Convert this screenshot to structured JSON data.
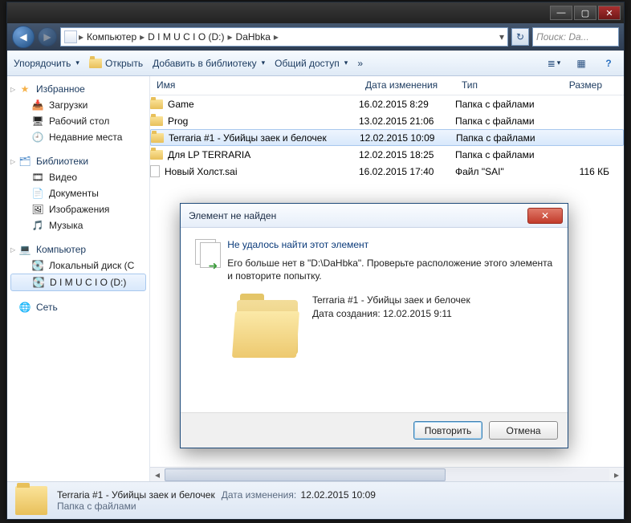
{
  "titlebar": {
    "min": "—",
    "max": "▢",
    "close": "✕"
  },
  "breadcrumbs": [
    "Компьютер",
    "D I M U C I O (D:)",
    "DaHbka"
  ],
  "search_placeholder": "Поиск: Da...",
  "toolbar": {
    "organize": "Упорядочить",
    "open": "Открыть",
    "add_lib": "Добавить в библиотеку",
    "share": "Общий доступ",
    "view": "≣",
    "preview": "▦",
    "help": "?"
  },
  "sidebar": {
    "favorites": {
      "label": "Избранное",
      "items": [
        "Загрузки",
        "Рабочий стол",
        "Недавние места"
      ]
    },
    "libraries": {
      "label": "Библиотеки",
      "items": [
        "Видео",
        "Документы",
        "Изображения",
        "Музыка"
      ]
    },
    "computer": {
      "label": "Компьютер",
      "items": [
        "Локальный диск (C",
        "D I M U C I O (D:)"
      ]
    },
    "network": {
      "label": "Сеть"
    }
  },
  "columns": {
    "name": "Имя",
    "date": "Дата изменения",
    "type": "Тип",
    "size": "Размер"
  },
  "files": [
    {
      "name": "Game",
      "date": "16.02.2015 8:29",
      "type": "Папка с файлами",
      "size": "",
      "kind": "folder"
    },
    {
      "name": "Prog",
      "date": "13.02.2015 21:06",
      "type": "Папка с файлами",
      "size": "",
      "kind": "folder"
    },
    {
      "name": "Terraria #1 - Убийцы заек и белочек",
      "date": "12.02.2015 10:09",
      "type": "Папка с файлами",
      "size": "",
      "kind": "folder",
      "selected": true
    },
    {
      "name": "Для LP TERRARIA",
      "date": "12.02.2015 18:25",
      "type": "Папка с файлами",
      "size": "",
      "kind": "folder"
    },
    {
      "name": "Новый Холст.sai",
      "date": "16.02.2015 17:40",
      "type": "Файл \"SAI\"",
      "size": "116 КБ",
      "kind": "file"
    }
  ],
  "status": {
    "name": "Terraria #1 - Убийцы заек и белочек",
    "date_label": "Дата изменения:",
    "date": "12.02.2015 10:09",
    "type": "Папка с файлами"
  },
  "dialog": {
    "title": "Элемент не найден",
    "heading": "Не удалось найти этот элемент",
    "body": "Его больше нет в \"D:\\DaHbka\". Проверьте расположение этого элемента и повторите попытку.",
    "item_name": "Terraria #1 - Убийцы заек и белочек",
    "item_date_label": "Дата создания:",
    "item_date": "12.02.2015 9:11",
    "retry": "Повторить",
    "cancel": "Отмена",
    "close": "✕"
  }
}
